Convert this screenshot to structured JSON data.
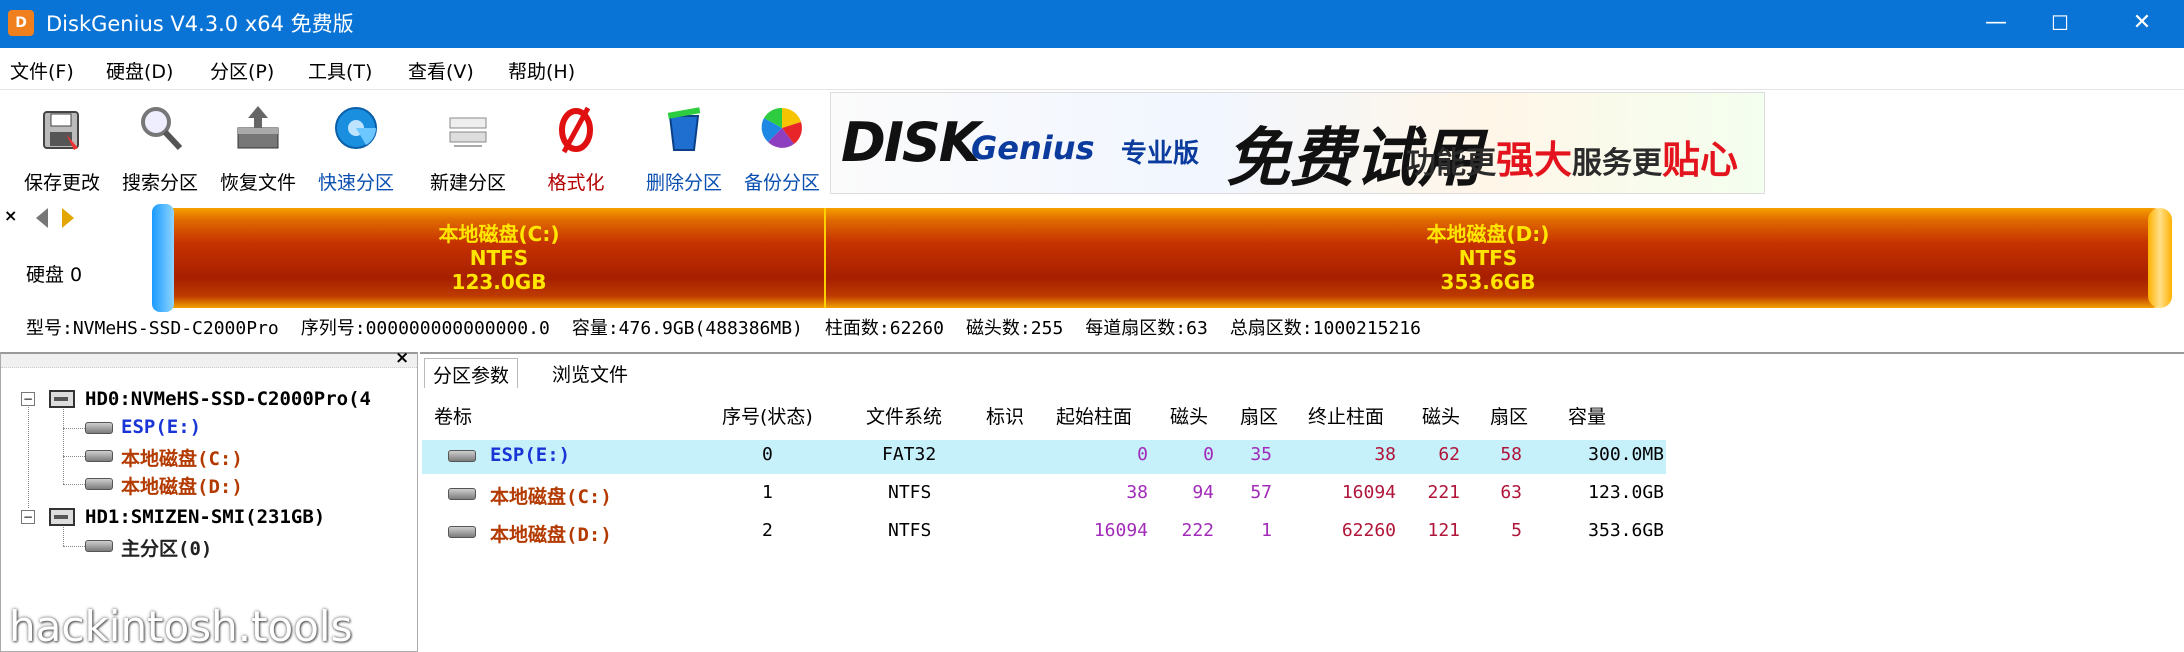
{
  "window": {
    "title": "DiskGenius V4.3.0 x64 免费版",
    "icon_letter": "D",
    "buttons": {
      "minimize": "—",
      "maximize": "☐",
      "close": "✕"
    }
  },
  "menu": [
    "文件(F)",
    "硬盘(D)",
    "分区(P)",
    "工具(T)",
    "查看(V)",
    "帮助(H)"
  ],
  "toolbar": [
    {
      "label": "保存更改",
      "icon": "save-icon"
    },
    {
      "label": "搜索分区",
      "icon": "search-icon"
    },
    {
      "label": "恢复文件",
      "icon": "restore-icon"
    },
    {
      "label": "快速分区",
      "icon": "quick-partition-icon"
    },
    {
      "label": "新建分区",
      "icon": "new-partition-icon"
    },
    {
      "label": "格式化",
      "icon": "format-icon"
    },
    {
      "label": "删除分区",
      "icon": "delete-icon"
    },
    {
      "label": "备份分区",
      "icon": "backup-icon"
    }
  ],
  "banner": {
    "logo": "DISK",
    "logo2": "Genius",
    "edition": "专业版",
    "free": "免费试用",
    "slogan_pre": "功能更",
    "slogan_red1": "强大",
    "slogan_mid": "服务更",
    "slogan_red2": "贴心"
  },
  "disk_map": {
    "label": "硬盘 0",
    "partitions": [
      {
        "name": "本地磁盘(C:)",
        "fs": "NTFS",
        "size": "123.0GB"
      },
      {
        "name": "本地磁盘(D:)",
        "fs": "NTFS",
        "size": "353.6GB"
      }
    ],
    "info": {
      "model": "型号:NVMeHS-SSD-C2000Pro",
      "serial": "序列号:000000000000000.0",
      "capacity": "容量:476.9GB(488386MB)",
      "cylinders": "柱面数:62260",
      "heads": "磁头数:255",
      "sectors_per_track": "每道扇区数:63",
      "total_sectors": "总扇区数:1000215216"
    }
  },
  "tree": {
    "disks": [
      {
        "label": "HD0:NVMeHS-SSD-C2000Pro(4",
        "partitions": [
          "ESP(E:)",
          "本地磁盘(C:)",
          "本地磁盘(D:)"
        ]
      },
      {
        "label": "HD1:SMIZEN-SMI(231GB)",
        "partitions": [
          "主分区(0)"
        ]
      }
    ],
    "watermark": "hackintosh.tools"
  },
  "tabs": [
    "分区参数",
    "浏览文件"
  ],
  "table": {
    "columns": [
      "卷标",
      "序号(状态)",
      "文件系统",
      "标识",
      "起始柱面",
      "磁头",
      "扇区",
      "终止柱面",
      "磁头",
      "扇区",
      "容量"
    ],
    "rows": [
      {
        "name": "ESP(E:)",
        "seq": "0",
        "fs": "FAT32",
        "id": "",
        "start_cyl": "0",
        "start_head": "0",
        "start_sec": "35",
        "end_cyl": "38",
        "end_head": "62",
        "end_sec": "58",
        "size": "300.0MB"
      },
      {
        "name": "本地磁盘(C:)",
        "seq": "1",
        "fs": "NTFS",
        "id": "",
        "start_cyl": "38",
        "start_head": "94",
        "start_sec": "57",
        "end_cyl": "16094",
        "end_head": "221",
        "end_sec": "63",
        "size": "123.0GB"
      },
      {
        "name": "本地磁盘(D:)",
        "seq": "2",
        "fs": "NTFS",
        "id": "",
        "start_cyl": "16094",
        "start_head": "222",
        "start_sec": "1",
        "end_cyl": "62260",
        "end_head": "121",
        "end_sec": "5",
        "size": "353.6GB"
      }
    ]
  },
  "colors": {
    "titlebar": "#0a74d6",
    "esp_text": "#1a35d6",
    "partition_text": "#b33a00",
    "start_values": "#a12bb8",
    "end_values": "#b0153a",
    "selected_row": "#c6f0fa"
  }
}
